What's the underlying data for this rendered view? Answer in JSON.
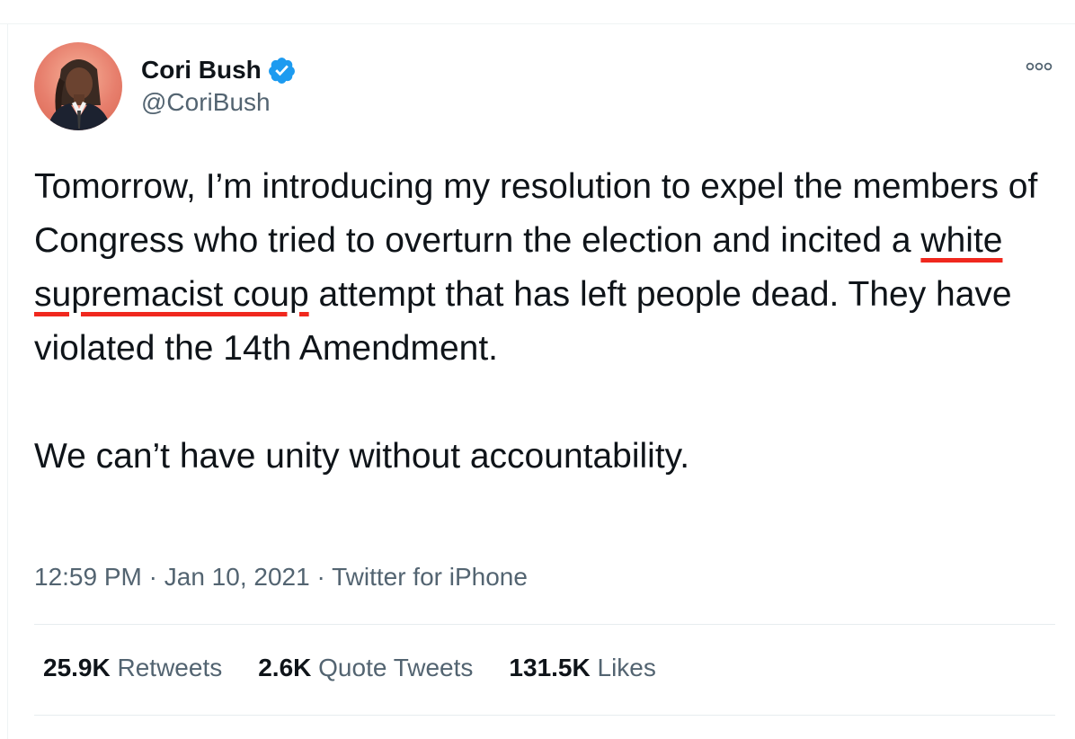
{
  "author": {
    "display_name": "Cori Bush",
    "handle": "@CoriBush",
    "verified_icon": "verified-badge-icon",
    "avatar_bg": "#e77f6d"
  },
  "tweet": {
    "line1_before": "Tomorrow, I’m introducing my resolution to expel the members of Congress who tried to overturn the election and incited a ",
    "highlight": "white supremacist coup",
    "line1_after": " attempt that has left people dead. They have violated the 14th Amendment.",
    "paragraph2": "We can’t have unity without accountability."
  },
  "meta": {
    "time": "12:59 PM",
    "sep1": " · ",
    "date": "Jan 10, 2021",
    "sep2": " · ",
    "source": "Twitter for iPhone"
  },
  "stats": {
    "retweets_count": "25.9K",
    "retweets_label": "Retweets",
    "quotes_count": "2.6K",
    "quotes_label": "Quote Tweets",
    "likes_count": "131.5K",
    "likes_label": "Likes"
  },
  "colors": {
    "text": "#0f1419",
    "secondary": "#536471",
    "verified": "#1d9bf0",
    "highlight_underline": "#f0281e"
  }
}
